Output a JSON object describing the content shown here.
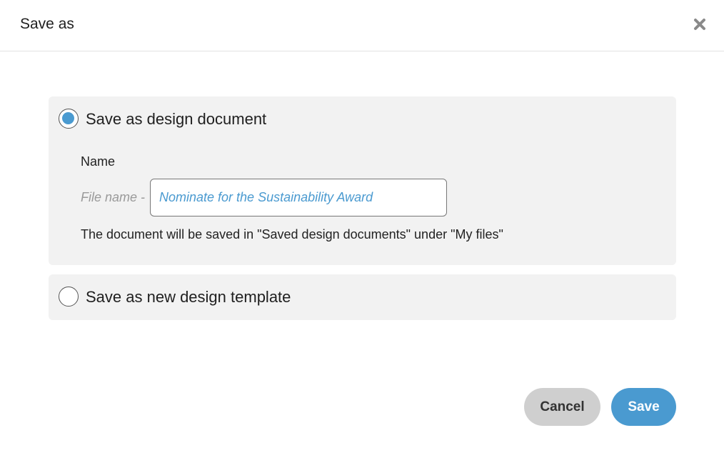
{
  "dialog": {
    "title": "Save as",
    "close_icon": "close-icon"
  },
  "options": {
    "design_document": {
      "label": "Save as design document",
      "selected": true,
      "name_label": "Name",
      "file_prefix": "File name -",
      "file_name_value": "Nominate for the Sustainability Award",
      "hint": "The document will be saved in \"Saved design documents\" under \"My files\""
    },
    "design_template": {
      "label": "Save as new design template",
      "selected": false
    }
  },
  "buttons": {
    "cancel_label": "Cancel",
    "save_label": "Save"
  },
  "colors": {
    "accent": "#4a9ad0",
    "panel_bg": "#f2f2f2",
    "cancel_bg": "#cfcfcf"
  }
}
